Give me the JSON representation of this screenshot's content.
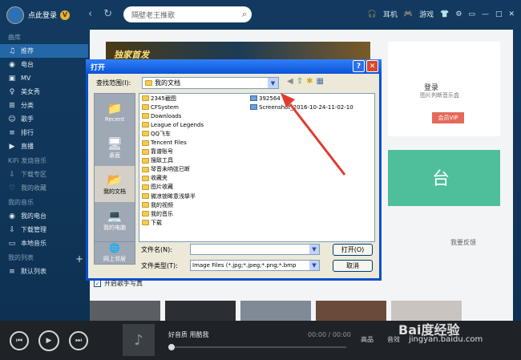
{
  "app": {
    "login_text": "点此登录",
    "search_placeholder": "隔壁老王推歌",
    "tools": [
      "耳机",
      "游戏"
    ]
  },
  "sidebar": {
    "sections": [
      {
        "title": "曲库",
        "items": [
          "推荐",
          "电台",
          "MV",
          "美女秀",
          "分类",
          "歌手",
          "排行",
          "直播"
        ]
      },
      {
        "title": "KiFi 发烧音乐",
        "items": [
          "下载专区",
          "我的收藏"
        ]
      },
      {
        "title": "我的音乐",
        "items": [
          "我的电台",
          "下载管理",
          "本地音乐"
        ]
      },
      {
        "title": "我的列表",
        "items": [
          "默认列表"
        ]
      }
    ],
    "active": "推荐"
  },
  "main": {
    "banner_text": "独家首发",
    "login_title": "登录",
    "login_hint": "图片判断音乐盒",
    "vip_label": "会员VIP",
    "tile_text": "台",
    "feedback": "我要反馈"
  },
  "player": {
    "song": "好音质 用酷我",
    "time": "00:00 / 00:00",
    "quality": "高品",
    "effect": "音效"
  },
  "dialog": {
    "title": "打开",
    "look_in_label": "查找范围(I):",
    "look_in_value": "我的文档",
    "places": [
      "Recent",
      "桌面",
      "我的文档",
      "我的电脑",
      "网上邻居"
    ],
    "files_col1": [
      "2345截图",
      "CFSystem",
      "Downloads",
      "League of Legends",
      "QQ飞车",
      "Tencent Files",
      "靠谱账号",
      "搜敌工具",
      "琴音未响弦已断",
      "收藏夹",
      "图片收藏",
      "微凉锁眸意浅挚半",
      "我的视频",
      "我的音乐",
      "下载"
    ],
    "files_col2": [
      "392564",
      "Screenshot_2016-10-24-11-02-10"
    ],
    "filename_label": "文件名(N):",
    "filename_value": "",
    "filetype_label": "文件类型(T):",
    "filetype_value": "Image Files (*.jpg;*.jpeg;*.png;*.bmp",
    "open_btn": "打开(O)",
    "cancel_btn": "取消"
  },
  "checkbox": {
    "label": "开启歌手写真",
    "checked": true
  },
  "watermark": {
    "line1": "Bai度经验",
    "line2": "jingyan.baidu.com"
  }
}
